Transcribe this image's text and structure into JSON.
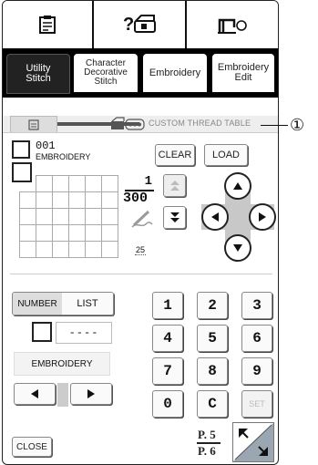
{
  "top_icons": [
    "clipboard-icon",
    "thread-question-icon",
    "sewing-machine-icon"
  ],
  "tabs": [
    {
      "label": "Utility\nStitch",
      "selected": true
    },
    {
      "label": "Character\nDecorative\nStitch",
      "selected": false
    },
    {
      "label": "Embroidery",
      "selected": false
    },
    {
      "label": "Embroidery\nEdit",
      "selected": false
    }
  ],
  "header": {
    "title": "CUSTOM THREAD TABLE"
  },
  "thread": {
    "number": "001",
    "name": "EMBROIDERY"
  },
  "buttons": {
    "clear": "CLEAR",
    "load": "LOAD",
    "close": "CLOSE",
    "number": "NUMBER",
    "list": "LIST",
    "set": "SET"
  },
  "counter": {
    "current": "1",
    "total": "300",
    "count": "25"
  },
  "color_code": "----",
  "brand": "EMBROIDERY",
  "keypad": [
    "1",
    "2",
    "3",
    "4",
    "5",
    "6",
    "7",
    "8",
    "9",
    "0",
    "C"
  ],
  "page": {
    "current": "P. 5",
    "total": "P. 6"
  },
  "callout": "①"
}
